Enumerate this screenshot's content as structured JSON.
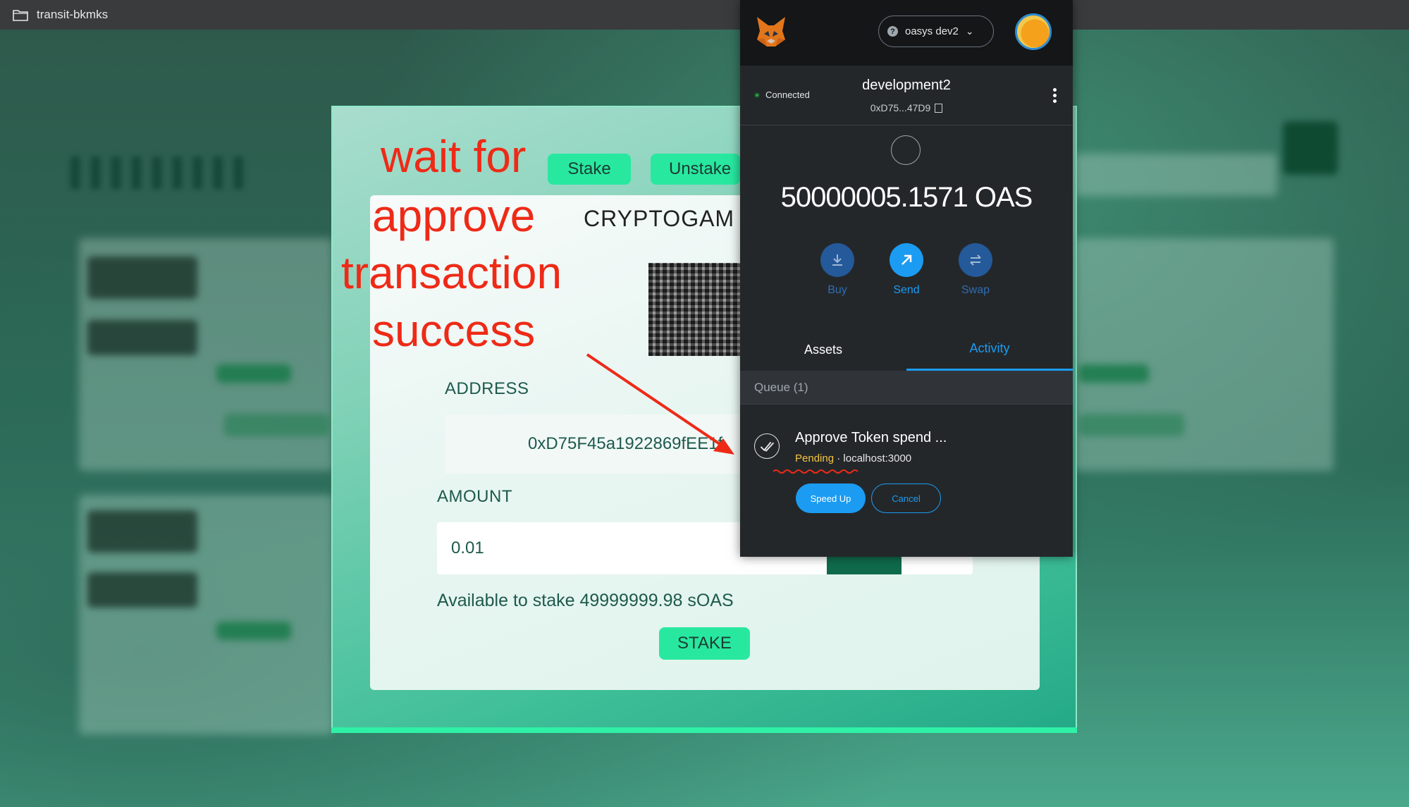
{
  "window": {
    "title": "transit-bkmks"
  },
  "stake_modal": {
    "tabs": [
      "Stake",
      "Unstake"
    ],
    "card_title": "CRYPTOGAM",
    "address_label": "ADDRESS",
    "address_value": "0xD75F45a1922869fEE1f",
    "amount_label": "AMOUNT",
    "amount_value": "0.01",
    "available_text": "Available to stake 49999999.98 sOAS",
    "submit_label": "STAKE"
  },
  "annotation": {
    "lines": [
      "wait for",
      "approve",
      "transaction",
      "success"
    ],
    "color": "#ee2a17"
  },
  "metamask": {
    "network": "oasys dev2",
    "connected_label": "Connected",
    "account_name": "development2",
    "account_address": "0xD75...47D9",
    "balance": "50000005.1571 OAS",
    "actions": [
      "Buy",
      "Send",
      "Swap"
    ],
    "tabs": {
      "assets": "Assets",
      "activity": "Activity"
    },
    "queue_label": "Queue (1)",
    "transaction": {
      "title": "Approve Token spend ...",
      "status": "Pending",
      "separator": "·",
      "origin": "localhost:3000",
      "speed_up_label": "Speed Up",
      "cancel_label": "Cancel"
    },
    "colors": {
      "accent": "#1b9cf2",
      "pending": "#f5c542",
      "background": "#24272a"
    }
  }
}
